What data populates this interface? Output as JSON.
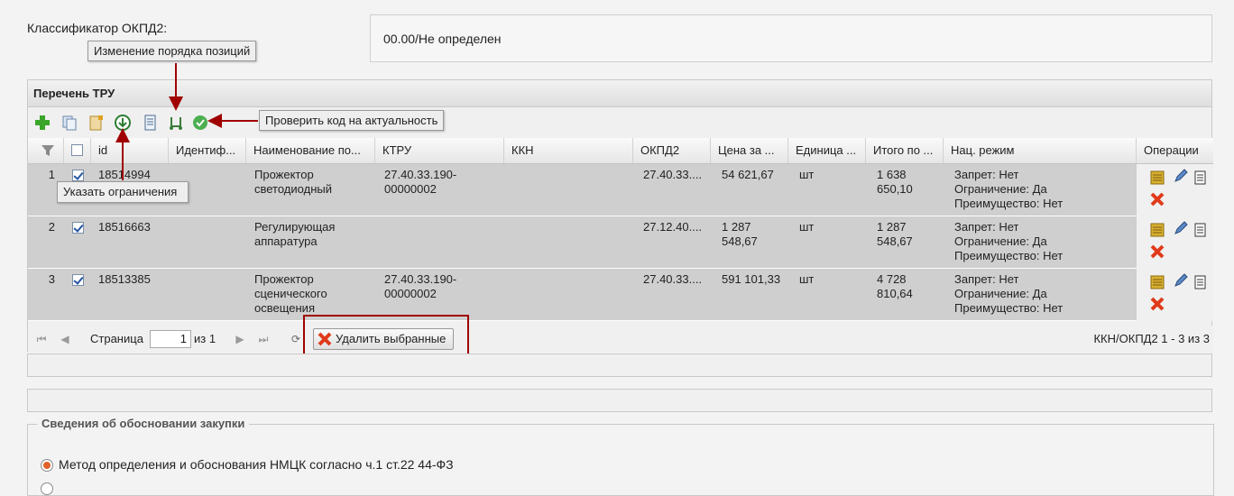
{
  "okpd": {
    "label": "Классификатор ОКПД2:",
    "value": "00.00/Не определен"
  },
  "callouts": {
    "reorder": "Изменение порядка позиций",
    "check_code": "Проверить код на актуальность",
    "set_restrictions": "Указать ограничения"
  },
  "panel": {
    "title": "Перечень ТРУ"
  },
  "toolbar_icons": [
    "add-icon",
    "copy-icon",
    "import-icon",
    "download-icon",
    "document-icon",
    "reorder-icon",
    "check-icon"
  ],
  "columns": [
    "id",
    "Идентиф...",
    "Наименование по...",
    "КТРУ",
    "ККН",
    "ОКПД2",
    "Цена за ...",
    "Единица ...",
    "Итого по ...",
    "Нац. режим",
    "Операции"
  ],
  "rows": [
    {
      "num": "1",
      "checked": true,
      "id": "18514994",
      "ident": "",
      "name": [
        "Прожектор",
        "светодиодный",
        ""
      ],
      "ktru": [
        "27.40.33.190-",
        "00000002"
      ],
      "kkn": "",
      "okpd2": "27.40.33....",
      "price": [
        "54 621,67",
        ""
      ],
      "unit": "шт",
      "total": [
        "1 638",
        "650,10"
      ],
      "nat": [
        "Запрет: Нет",
        "Ограничение: Да",
        "Преимущество: Нет"
      ]
    },
    {
      "num": "2",
      "checked": true,
      "id": "18516663",
      "ident": "",
      "name": [
        "Регулирующая",
        "аппаратура",
        ""
      ],
      "ktru": [
        "",
        ""
      ],
      "kkn": "",
      "okpd2": "27.12.40....",
      "price": [
        "1 287",
        "548,67"
      ],
      "unit": "шт",
      "total": [
        "1 287",
        "548,67"
      ],
      "nat": [
        "Запрет: Нет",
        "Ограничение: Да",
        "Преимущество: Нет"
      ]
    },
    {
      "num": "3",
      "checked": true,
      "id": "18513385",
      "ident": "",
      "name": [
        "Прожектор",
        "сценического",
        "освещения"
      ],
      "ktru": [
        "27.40.33.190-",
        "00000002"
      ],
      "kkn": "",
      "okpd2": "27.40.33....",
      "price": [
        "591 101,33",
        ""
      ],
      "unit": "шт",
      "total": [
        "4 728",
        "810,64"
      ],
      "nat": [
        "Запрет: Нет",
        "Ограничение: Да",
        "Преимущество: Нет"
      ]
    }
  ],
  "pager": {
    "page_label": "Страница",
    "page_value": "1",
    "of_label": "из 1",
    "delete_label": "Удалить выбранные",
    "summary": "ККН/ОКПД2 1 - 3 из 3"
  },
  "justification": {
    "legend": "Сведения об обосновании закупки",
    "option1": "Метод определения и обоснования НМЦК согласно ч.1 ст.22 44-ФЗ"
  },
  "colors": {
    "accent_red": "#a00000",
    "row_bg": "#cfcfcf",
    "radio_on": "#e0602a"
  }
}
